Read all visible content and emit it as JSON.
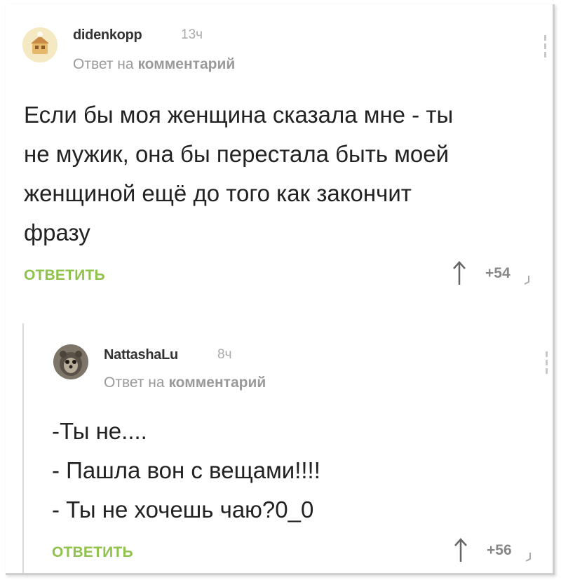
{
  "comments": [
    {
      "username": "didenkopp",
      "time": "13ч",
      "reply_prefix": "Ответ на",
      "reply_link": "комментарий",
      "lines": [
        "Если бы моя женщина сказала мне - ты",
        "не мужик, она бы перестала быть моей",
        "женщиной ещё до того как закончит",
        "фразу"
      ],
      "reply_label": "ОТВЕТИТЬ",
      "score": "+54"
    },
    {
      "username": "NattashaLu",
      "time": "8ч",
      "reply_prefix": "Ответ на",
      "reply_link": "комментарий",
      "lines": [
        "-Ты не....",
        "- Пашла вон с вещами!!!!",
        "- Ты не хочешь чаю?0_0"
      ],
      "reply_label": "ОТВЕТИТЬ",
      "score": "+56"
    }
  ],
  "colors": {
    "accent": "#8fc24a",
    "muted": "#9a9a9a",
    "text": "#222222"
  },
  "icons": [
    "avatar",
    "kebab-menu-icon",
    "upvote-arrow-icon",
    "downvote-icon"
  ]
}
